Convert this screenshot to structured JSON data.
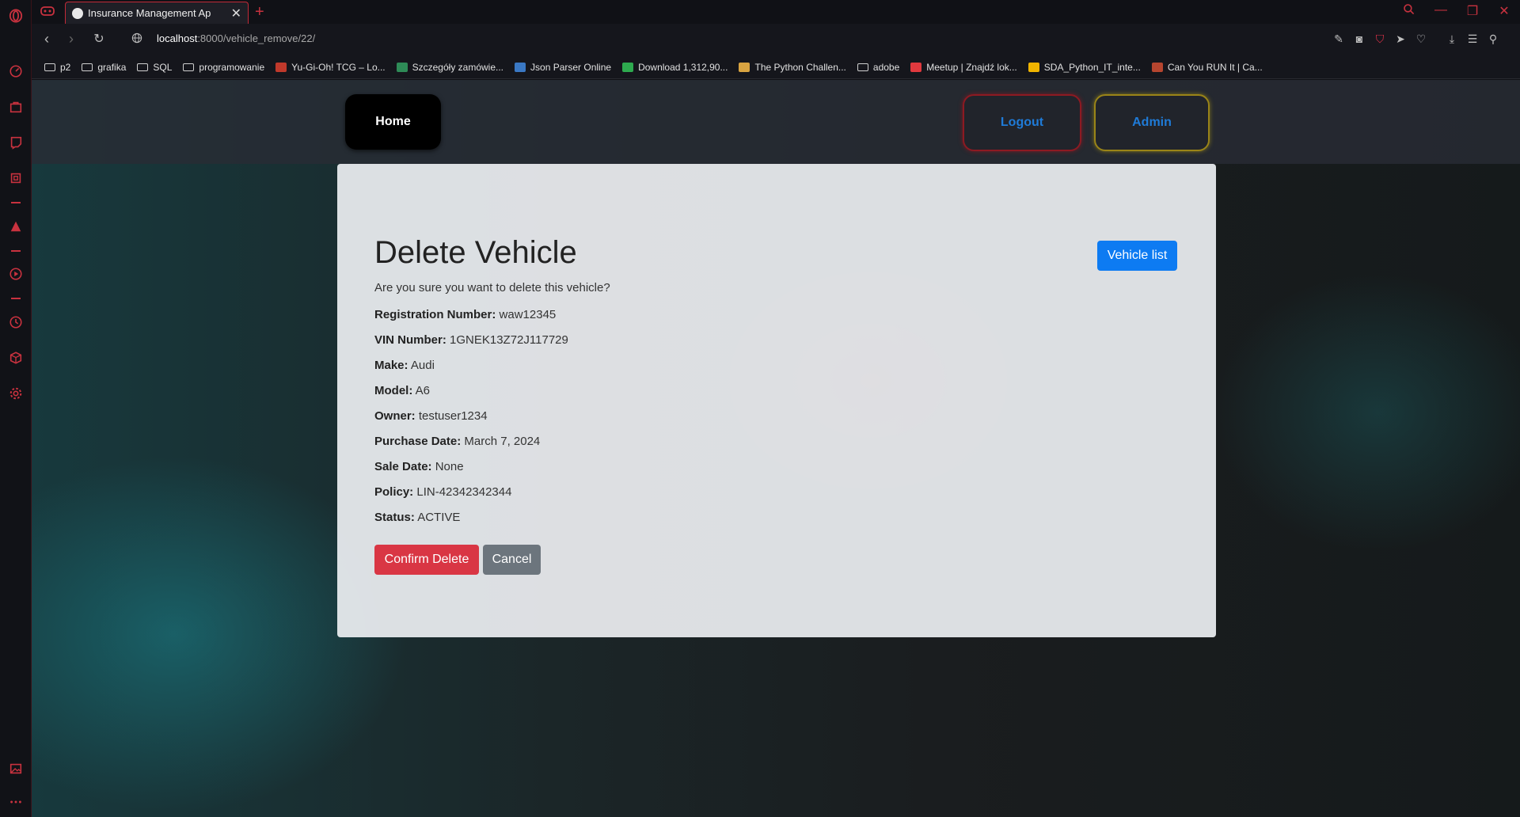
{
  "browser": {
    "tab": {
      "title": "Insurance Management Ap"
    },
    "url": {
      "host": "localhost",
      "path": ":8000/vehicle_remove/22/"
    },
    "bookmarks": [
      {
        "label": "p2",
        "kind": "folder"
      },
      {
        "label": "grafika",
        "kind": "folder"
      },
      {
        "label": "SQL",
        "kind": "folder"
      },
      {
        "label": "programowanie",
        "kind": "folder"
      },
      {
        "label": "Yu-Gi-Oh! TCG – Lo...",
        "kind": "site",
        "color": "#c0392b"
      },
      {
        "label": "Szczegóły zamówie...",
        "kind": "site",
        "color": "#2e8b57"
      },
      {
        "label": "Json Parser Online",
        "kind": "site",
        "color": "#3a78c4"
      },
      {
        "label": "Download 1,312,90...",
        "kind": "site",
        "color": "#2eaa4f"
      },
      {
        "label": "The Python Challen...",
        "kind": "site",
        "color": "#d9a441"
      },
      {
        "label": "adobe",
        "kind": "folder"
      },
      {
        "label": "Meetup | Znajdź lok...",
        "kind": "site",
        "color": "#e0393e"
      },
      {
        "label": "SDA_Python_IT_inte...",
        "kind": "site",
        "color": "#f0b400"
      },
      {
        "label": "Can You RUN It | Ca...",
        "kind": "site",
        "color": "#b5452f"
      }
    ],
    "accent_color": "#c9323f"
  },
  "navbar": {
    "home": "Home",
    "logout": "Logout",
    "admin": "Admin"
  },
  "card": {
    "title": "Delete Vehicle",
    "vehicle_list_button": "Vehicle list",
    "question": "Are you sure you want to delete this vehicle?",
    "details": [
      {
        "label": "Registration Number:",
        "value": "waw12345"
      },
      {
        "label": "VIN Number:",
        "value": "1GNEK13Z72J117729"
      },
      {
        "label": "Make:",
        "value": "Audi"
      },
      {
        "label": "Model:",
        "value": "A6"
      },
      {
        "label": "Owner:",
        "value": "testuser1234"
      },
      {
        "label": "Purchase Date:",
        "value": "March 7, 2024"
      },
      {
        "label": "Sale Date:",
        "value": "None"
      },
      {
        "label": "Policy:",
        "value": "LIN-42342342344"
      },
      {
        "label": "Status:",
        "value": "ACTIVE"
      }
    ],
    "confirm_button": "Confirm Delete",
    "cancel_button": "Cancel",
    "colors": {
      "primary": "#0d7bf2",
      "danger": "#d93644",
      "secondary": "#6c757d"
    }
  }
}
